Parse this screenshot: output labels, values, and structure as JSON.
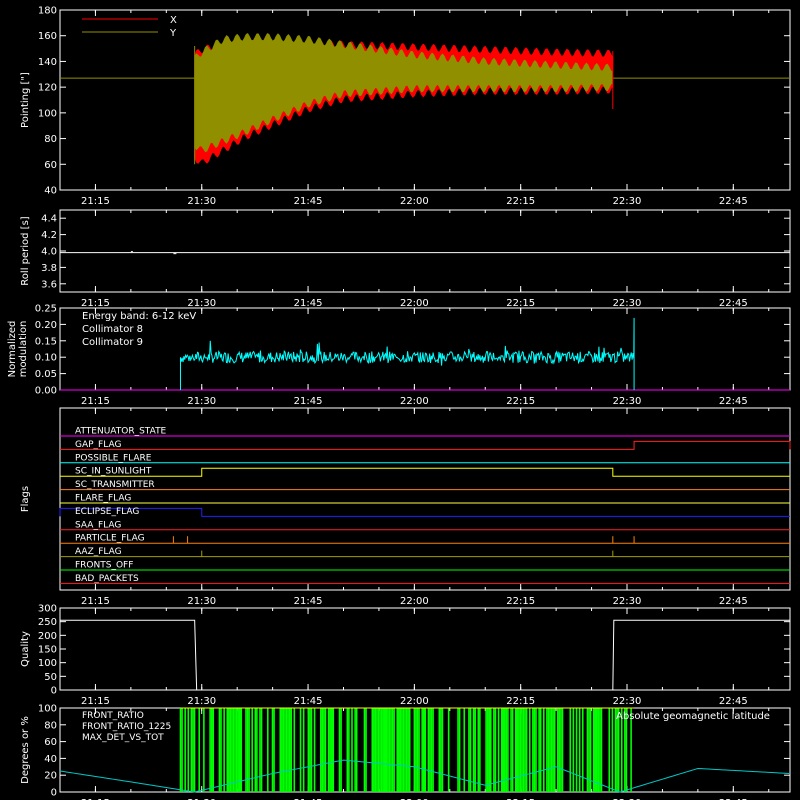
{
  "time_axis": {
    "ticks": [
      "21:15",
      "21:30",
      "21:45",
      "22:00",
      "22:15",
      "22:30",
      "22:45"
    ]
  },
  "chart_data": [
    {
      "id": "pointing",
      "type": "line",
      "ylabel": "Pointing [\"]",
      "ylim": [
        40,
        180
      ],
      "yticks": [
        "40",
        "60",
        "80",
        "100",
        "120",
        "140",
        "160",
        "180"
      ],
      "legend": "top-left",
      "series": [
        {
          "name": "X",
          "color": "#ff0000"
        },
        {
          "name": "Y",
          "color": "#8f8f00"
        }
      ],
      "baseline": 127,
      "data_start": "21:29",
      "data_end": "22:28",
      "x_envelope": {
        "time": [
          "21:29",
          "21:30",
          "21:33",
          "21:36",
          "21:40",
          "21:45",
          "21:50",
          "22:00",
          "22:10",
          "22:20",
          "22:28"
        ],
        "min": [
          62,
          58,
          68,
          78,
          88,
          100,
          108,
          112,
          114,
          114,
          115
        ],
        "max": [
          148,
          152,
          156,
          158,
          158,
          157,
          156,
          154,
          152,
          150,
          149
        ]
      },
      "y_envelope": {
        "time": [
          "21:29",
          "21:30",
          "21:33",
          "21:36",
          "21:40",
          "21:45",
          "21:50",
          "22:00",
          "22:10",
          "22:20",
          "22:28"
        ],
        "min": [
          72,
          68,
          75,
          82,
          92,
          104,
          112,
          116,
          116,
          116,
          117
        ],
        "max": [
          145,
          150,
          160,
          162,
          162,
          160,
          156,
          148,
          143,
          140,
          138
        ]
      }
    },
    {
      "id": "roll-period",
      "type": "line",
      "ylabel": "Roll period [s]",
      "ylim": [
        3.5,
        4.5
      ],
      "yticks": [
        "3.6",
        "3.8",
        "4.0",
        "4.2",
        "4.4"
      ],
      "series": [
        {
          "name": "",
          "color": "#ffffff",
          "value": 3.98
        }
      ]
    },
    {
      "id": "modulation",
      "type": "line",
      "ylabel": "Normalized modulation",
      "ylim": [
        0,
        0.25
      ],
      "yticks": [
        "0.00",
        "0.05",
        "0.10",
        "0.15",
        "0.20",
        "0.25"
      ],
      "legend_title": "Energy band: 6-12 keV",
      "series": [
        {
          "name": "Collimator 8",
          "color": "#00ffff",
          "start": "21:27",
          "end": "22:31",
          "mean": 0.1,
          "spike": 0.22
        },
        {
          "name": "Collimator 9",
          "color": "#ff00ff",
          "value": 0.0
        }
      ]
    },
    {
      "id": "flags",
      "type": "line",
      "ylabel": "Flags",
      "flags": [
        {
          "name": "ATTENUATOR_STATE",
          "color": "#ff00ff",
          "high_from": null,
          "high_to": null
        },
        {
          "name": "GAP_FLAG",
          "color": "#ff2020",
          "high_from": "22:31",
          "high_to": "22:53"
        },
        {
          "name": "POSSIBLE_FLARE",
          "color": "#00ffff",
          "high_from": null,
          "high_to": null
        },
        {
          "name": "SC_IN_SUNLIGHT",
          "color": "#ffff00",
          "high_from": "21:30",
          "high_to": "22:28"
        },
        {
          "name": "SC_TRANSMITTER",
          "color": "#ff8020",
          "high_from": null,
          "high_to": null
        },
        {
          "name": "FLARE_FLAG",
          "color": "#ffff40",
          "high_from": null,
          "high_to": null
        },
        {
          "name": "ECLIPSE_FLAG",
          "color": "#2020ff",
          "high_from": "21:10",
          "high_to": "21:30"
        },
        {
          "name": "SAA_FLAG",
          "color": "#ff2020",
          "high_from": null,
          "high_to": null
        },
        {
          "name": "PARTICLE_FLAG",
          "color": "#ff8000",
          "high_from": null,
          "high_to": null
        },
        {
          "name": "AAZ_FLAG",
          "color": "#a0a000",
          "high_from": null,
          "high_to": null
        },
        {
          "name": "FRONTS_OFF",
          "color": "#00ff00",
          "high_from": null,
          "high_to": null
        },
        {
          "name": "BAD_PACKETS",
          "color": "#ff2020",
          "high_from": null,
          "high_to": null
        }
      ]
    },
    {
      "id": "quality",
      "type": "line",
      "ylabel": "Quality",
      "ylim": [
        0,
        300
      ],
      "yticks": [
        "0",
        "50",
        "100",
        "150",
        "200",
        "250",
        "300"
      ],
      "series": [
        {
          "name": "",
          "color": "#ffffff",
          "high": 255,
          "low_from": "21:29",
          "low_to": "22:28"
        }
      ]
    },
    {
      "id": "ratios",
      "type": "line",
      "ylabel": "Degrees or %",
      "ylim": [
        0,
        100
      ],
      "yticks": [
        "0",
        "20",
        "40",
        "60",
        "80",
        "100"
      ],
      "series": [
        {
          "name": "FRONT_RATIO",
          "color": "#ffff00"
        },
        {
          "name": "FRONT_RATIO_1225",
          "color": "#00ff00",
          "start": "21:27",
          "end": "22:31"
        },
        {
          "name": "MAX_DET_VS_TOT",
          "color": "#ff8020"
        },
        {
          "name": "Absolute geomagnetic latitude",
          "color": "#00c8c8",
          "time": [
            "21:10",
            "21:20",
            "21:29",
            "21:40",
            "21:50",
            "22:00",
            "22:10",
            "22:20",
            "22:29",
            "22:40",
            "22:53"
          ],
          "values": [
            25,
            12,
            0,
            22,
            38,
            30,
            8,
            30,
            0,
            28,
            22
          ]
        }
      ]
    }
  ]
}
